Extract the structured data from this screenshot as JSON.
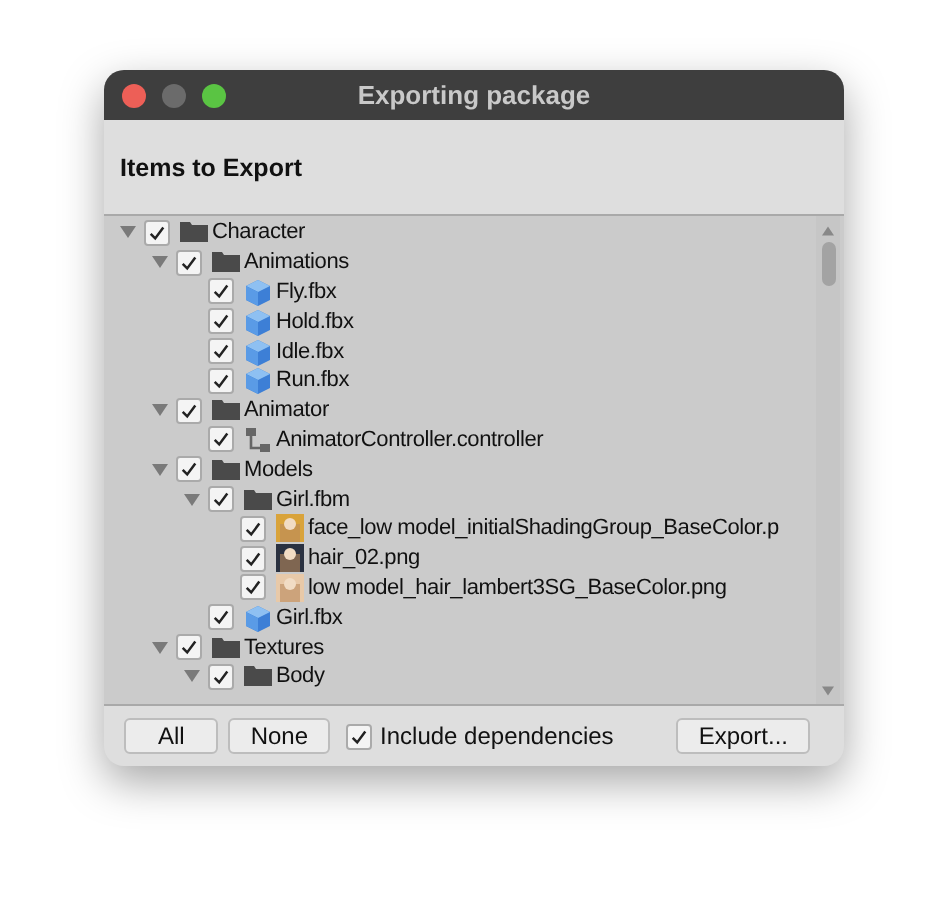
{
  "window": {
    "title": "Exporting package"
  },
  "header": "Items to Export",
  "tree": [
    {
      "label": "Character",
      "kind": "folder",
      "checked": true,
      "expanded": true,
      "children": [
        {
          "label": "Animations",
          "kind": "folder",
          "checked": true,
          "expanded": true,
          "children": [
            {
              "label": "Fly.fbx",
              "kind": "model",
              "checked": true
            },
            {
              "label": "Hold.fbx",
              "kind": "model",
              "checked": true
            },
            {
              "label": "Idle.fbx",
              "kind": "model",
              "checked": true
            },
            {
              "label": "Run.fbx",
              "kind": "model",
              "checked": true
            }
          ]
        },
        {
          "label": "Animator",
          "kind": "folder",
          "checked": true,
          "expanded": true,
          "children": [
            {
              "label": "AnimatorController.controller",
              "kind": "controller",
              "checked": true
            }
          ]
        },
        {
          "label": "Models",
          "kind": "folder",
          "checked": true,
          "expanded": true,
          "children": [
            {
              "label": "Girl.fbm",
              "kind": "folder",
              "checked": true,
              "expanded": true,
              "children": [
                {
                  "label": "face_low model_initialShadingGroup_BaseColor.p",
                  "checked": true
                },
                {
                  "label": "hair_02.png",
                  "checked": true
                },
                {
                  "label": "low model_hair_lambert3SG_BaseColor.png",
                  "checked": true
                }
              ]
            },
            {
              "label": "Girl.fbx",
              "kind": "model",
              "checked": true
            }
          ]
        },
        {
          "label": "Textures",
          "kind": "folder",
          "checked": true,
          "expanded": true,
          "children": [
            {
              "label": "Body",
              "kind": "folder",
              "checked": true,
              "expanded": true
            }
          ]
        }
      ]
    }
  ],
  "buttons": {
    "all": "All",
    "none": "None",
    "export": "Export..."
  },
  "include_dependencies": {
    "label": "Include dependencies",
    "checked": true
  }
}
